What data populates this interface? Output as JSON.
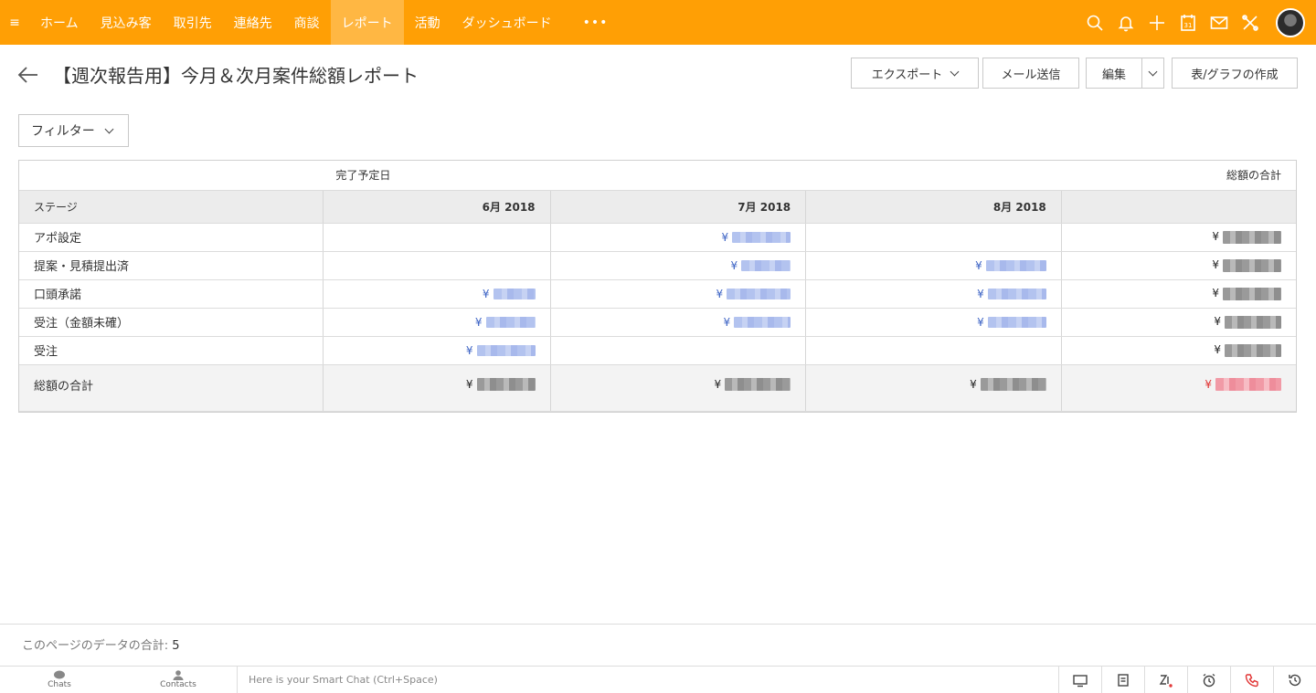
{
  "nav": {
    "items": [
      {
        "label": "ホーム",
        "active": false
      },
      {
        "label": "見込み客",
        "active": false
      },
      {
        "label": "取引先",
        "active": false
      },
      {
        "label": "連絡先",
        "active": false
      },
      {
        "label": "商談",
        "active": false
      },
      {
        "label": "レポート",
        "active": true
      },
      {
        "label": "活動",
        "active": false
      },
      {
        "label": "ダッシュボード",
        "active": false
      }
    ],
    "more": "•••",
    "calendar_day": "31",
    "accent": "#ff9f05"
  },
  "header": {
    "title": "【週次報告用】今月＆次月案件総額レポート",
    "export_label": "エクスポート",
    "email_label": "メール送信",
    "edit_label": "編集",
    "create_label": "表/グラフの作成"
  },
  "filter": {
    "label": "フィルター"
  },
  "report": {
    "group_caption": "完了予定日",
    "total_caption": "総額の合計",
    "stage_header": "ステージ",
    "columns": [
      "6月 2018",
      "7月 2018",
      "8月 2018",
      ""
    ],
    "currency": "¥",
    "rows": [
      {
        "stage": "アポ設定",
        "cells": [
          "",
          "¥",
          "",
          "¥"
        ]
      },
      {
        "stage": "提案・見積提出済",
        "cells": [
          "",
          "¥",
          "¥",
          "¥"
        ]
      },
      {
        "stage": "口頭承諾",
        "cells": [
          "¥",
          "¥",
          "¥",
          "¥"
        ]
      },
      {
        "stage": "受注（金額未確）",
        "cells": [
          "¥",
          "¥",
          "¥",
          "¥"
        ]
      },
      {
        "stage": "受注",
        "cells": [
          "¥",
          "",
          "",
          "¥"
        ]
      }
    ],
    "total_row": {
      "label": "総額の合計",
      "cells": [
        "¥",
        "¥",
        "¥",
        "¥"
      ]
    }
  },
  "footer": {
    "record_count_label": "このページのデータの合計:",
    "record_count_value": "5"
  },
  "chatbar": {
    "chats_label": "Chats",
    "contacts_label": "Contacts",
    "smart_chat_placeholder": "Here is your Smart Chat (Ctrl+Space)"
  }
}
